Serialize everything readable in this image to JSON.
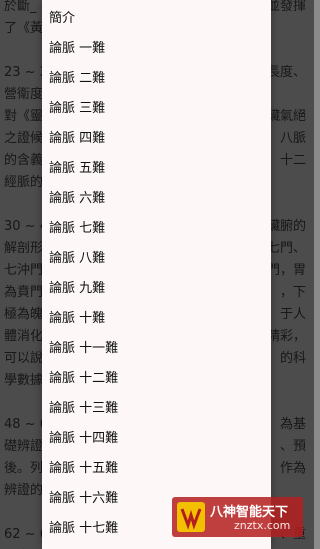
{
  "background": {
    "lines": [
      {
        "left": "於斷_",
        "right": "，並發揮"
      },
      {
        "left": "了《黃",
        "right": ""
      },
      {
        "left": "",
        "right": ""
      },
      {
        "left": "23 ~ 2",
        "right": "長度、"
      },
      {
        "left": "營衛度",
        "right": ""
      },
      {
        "left": "對《靈",
        "right": "臟氣絕"
      },
      {
        "left": "之證候",
        "right": "八脈"
      },
      {
        "left": "的含義",
        "right": "十二"
      },
      {
        "left": "經脈的",
        "right": ""
      },
      {
        "left": "",
        "right": ""
      },
      {
        "left": "30 ~ 4",
        "right": "臟腑的"
      },
      {
        "left": "解剖形",
        "right": "七門、"
      },
      {
        "left": "七沖門",
        "right": "門，胃"
      },
      {
        "left": "為賁門",
        "right": "，下"
      },
      {
        "left": "極為魄",
        "right": "于人"
      },
      {
        "left": "體消化",
        "right": "精彩，"
      },
      {
        "left": "可以說",
        "right": "的科"
      },
      {
        "left": "學數據",
        "right": ""
      },
      {
        "left": "",
        "right": ""
      },
      {
        "left": "48 ~ 6",
        "right": "為基"
      },
      {
        "left": "礎辨證",
        "right": "、預"
      },
      {
        "left": "後。列",
        "right": "作為"
      },
      {
        "left": "辨證的",
        "right": ""
      },
      {
        "left": "",
        "right": ""
      },
      {
        "left": "62 ~ 6",
        "right": "、重"
      },
      {
        "left": "、俞穴",
        "right": ""
      }
    ]
  },
  "menu": {
    "items": [
      "簡介",
      "論脈 一難",
      "論脈 二難",
      "論脈 三難",
      "論脈 四難",
      "論脈 五難",
      "論脈 六難",
      "論脈 七難",
      "論脈 八難",
      "論脈 九難",
      "論脈 十難",
      "論脈 十一難",
      "論脈 十二難",
      "論脈 十三難",
      "論脈 十四難",
      "論脈 十五難",
      "論脈 十六難",
      "論脈 十七難"
    ]
  },
  "watermark": {
    "title": "八神智能天下",
    "subtitle": "znztx.com"
  },
  "colors": {
    "menu_bg": "#fdf8f7",
    "scrim": "#000000",
    "watermark_bg": "#b41e1e"
  }
}
